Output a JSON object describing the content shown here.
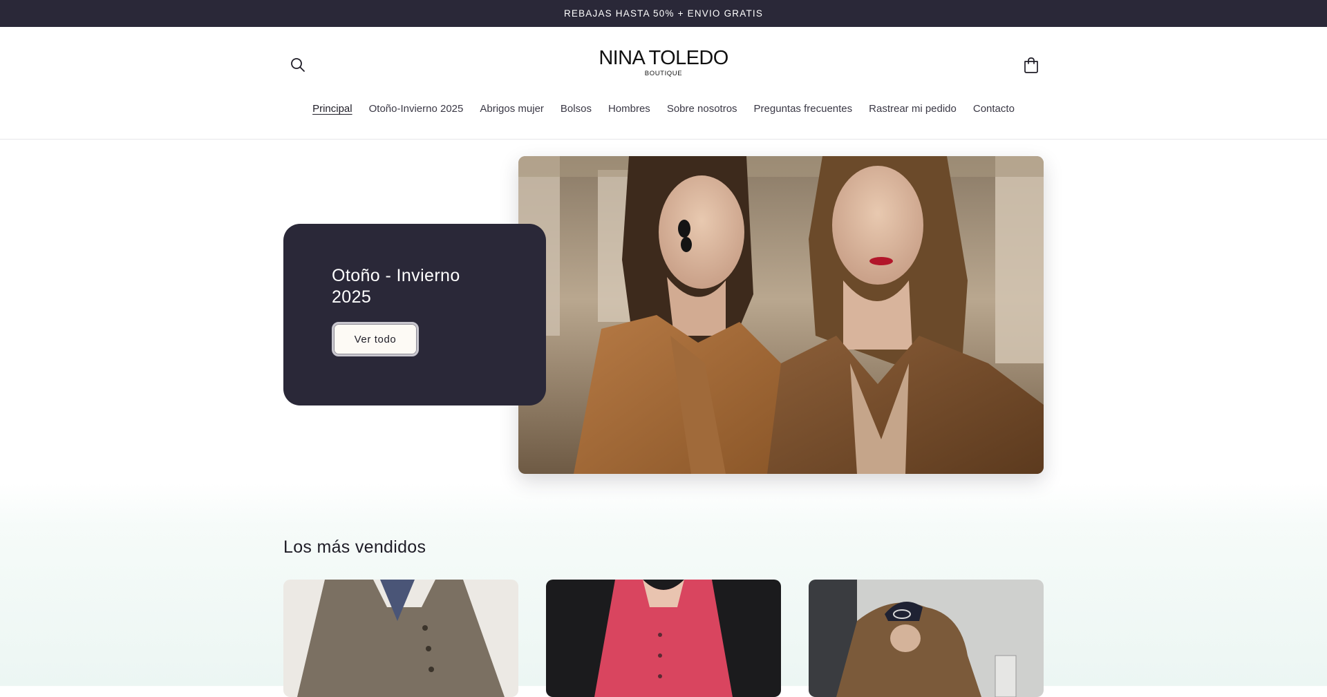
{
  "announcement": {
    "text": "REBAJAS HASTA 50% + ENVIO GRATIS"
  },
  "header": {
    "logo_main": "NINA TOLEDO",
    "logo_sub": "BOUTIQUE",
    "icons": {
      "search": "search-icon",
      "cart": "cart-icon"
    }
  },
  "nav": {
    "items": [
      {
        "label": "Principal",
        "active": true
      },
      {
        "label": "Otoño-Invierno 2025"
      },
      {
        "label": "Abrigos mujer"
      },
      {
        "label": "Bolsos"
      },
      {
        "label": "Hombres"
      },
      {
        "label": "Sobre nosotros"
      },
      {
        "label": "Preguntas frecuentes"
      },
      {
        "label": "Rastrear mi pedido"
      },
      {
        "label": "Contacto"
      }
    ]
  },
  "hero": {
    "title": "Otoño - Invierno 2025",
    "button_label": "Ver todo"
  },
  "bestsellers": {
    "title": "Los más vendidos"
  },
  "colors": {
    "dark": "#2a2838",
    "button_bg": "#fdfaf5",
    "page_bg": "#ffffff"
  }
}
